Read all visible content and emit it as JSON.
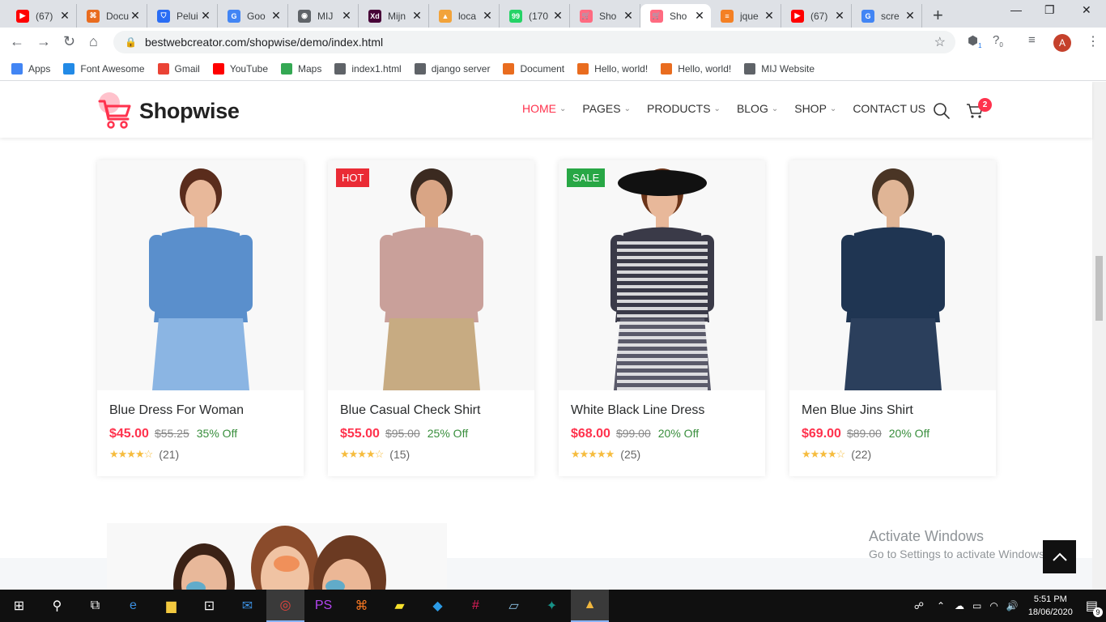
{
  "browser": {
    "tabs": [
      {
        "label": "(67)",
        "color": "#ff0000",
        "glyph": "▶"
      },
      {
        "label": "Docu",
        "color": "#e96c1f",
        "glyph": "⌘"
      },
      {
        "label": "Pelui",
        "color": "#2a6df4",
        "glyph": "⛉"
      },
      {
        "label": "Goo",
        "color": "#4285f4",
        "glyph": "G"
      },
      {
        "label": "MIJ",
        "color": "#5f6368",
        "glyph": "◉"
      },
      {
        "label": "Mijn",
        "color": "#470137",
        "glyph": "Xd"
      },
      {
        "label": "loca",
        "color": "#f2a33a",
        "glyph": "▲"
      },
      {
        "label": "(170",
        "color": "#25d366",
        "glyph": "99"
      },
      {
        "label": "Sho",
        "color": "#ff6b81",
        "glyph": "🛒"
      },
      {
        "label": "Sho",
        "color": "#ff6b81",
        "glyph": "🛒",
        "active": true
      },
      {
        "label": "jque",
        "color": "#f48024",
        "glyph": "≡"
      },
      {
        "label": "(67)",
        "color": "#ff0000",
        "glyph": "▶"
      },
      {
        "label": "scre",
        "color": "#4285f4",
        "glyph": "G"
      }
    ],
    "url": "bestwebcreator.com/shopwise/demo/index.html",
    "bookmarks": [
      {
        "label": "Apps",
        "color": "#4285f4"
      },
      {
        "label": "Font Awesome",
        "color": "#228ae6"
      },
      {
        "label": "Gmail",
        "color": "#ea4335"
      },
      {
        "label": "YouTube",
        "color": "#ff0000"
      },
      {
        "label": "Maps",
        "color": "#34a853"
      },
      {
        "label": "index1.html",
        "color": "#5f6368"
      },
      {
        "label": "django server",
        "color": "#5f6368"
      },
      {
        "label": "Document",
        "color": "#e96c1f"
      },
      {
        "label": "Hello, world!",
        "color": "#e96c1f"
      },
      {
        "label": "Hello, world!",
        "color": "#e96c1f"
      },
      {
        "label": "MIJ Website",
        "color": "#5f6368"
      }
    ],
    "ext_badges": [
      "1",
      "0"
    ],
    "profile_initial": "A"
  },
  "site": {
    "logo_text": "Shopwise",
    "nav": [
      {
        "label": "HOME",
        "active": true,
        "dropdown": true
      },
      {
        "label": "PAGES",
        "dropdown": true
      },
      {
        "label": "PRODUCTS",
        "dropdown": true
      },
      {
        "label": "BLOG",
        "dropdown": true
      },
      {
        "label": "SHOP",
        "dropdown": true
      },
      {
        "label": "CONTACT US",
        "dropdown": false
      }
    ],
    "cart_count": "2",
    "accent": "#ff324d"
  },
  "products": [
    {
      "name": "Blue Dress For Woman",
      "price": "$45.00",
      "old_price": "$55.25",
      "off": "35% Off",
      "rating": 4,
      "reviews": "(21)",
      "badge": "",
      "badge_color": "",
      "figure": {
        "top": "#5a8fcc",
        "bottom": "#8bb5e3",
        "hair": "#5a2c1c",
        "skin": "#e8b89a"
      }
    },
    {
      "name": "Blue Casual Check Shirt",
      "price": "$55.00",
      "old_price": "$95.00",
      "off": "25% Off",
      "rating": 3.5,
      "reviews": "(15)",
      "badge": "HOT",
      "badge_color": "#ea2b35",
      "figure": {
        "top": "#c9a09a",
        "bottom": "#c7ab82",
        "hair": "#3b2a20",
        "skin": "#d9a585"
      }
    },
    {
      "name": "White Black Line Dress",
      "price": "$68.00",
      "old_price": "$99.00",
      "off": "20% Off",
      "rating": 4.5,
      "reviews": "(25)",
      "badge": "SALE",
      "badge_color": "#28a745",
      "figure": {
        "top": "#3a3a48",
        "bottom": "#5a5a6a",
        "hair": "#6b3419",
        "skin": "#e8b89a"
      }
    },
    {
      "name": "Men Blue Jins Shirt",
      "price": "$69.00",
      "old_price": "$89.00",
      "off": "20% Off",
      "rating": 3.5,
      "reviews": "(22)",
      "badge": "",
      "badge_color": "",
      "figure": {
        "top": "#1f3552",
        "bottom": "#2b3f5c",
        "hair": "#4a3525",
        "skin": "#e0b596"
      }
    }
  ],
  "watermark": {
    "line1": "Activate Windows",
    "line2": "Go to Settings to activate Windows."
  },
  "taskbar": {
    "time": "5:51 PM",
    "date": "18/06/2020",
    "notifications": "9",
    "apps": [
      "windows-icon",
      "search-icon",
      "task-view-icon",
      "edge-icon",
      "file-explorer-icon",
      "store-icon",
      "mail-icon",
      "chrome-icon",
      "phpstorm-icon",
      "xampp-icon",
      "sticky-notes-icon",
      "vscode-icon",
      "slack-icon",
      "notepad-icon",
      "git-kraken-icon",
      "photos-icon"
    ]
  }
}
